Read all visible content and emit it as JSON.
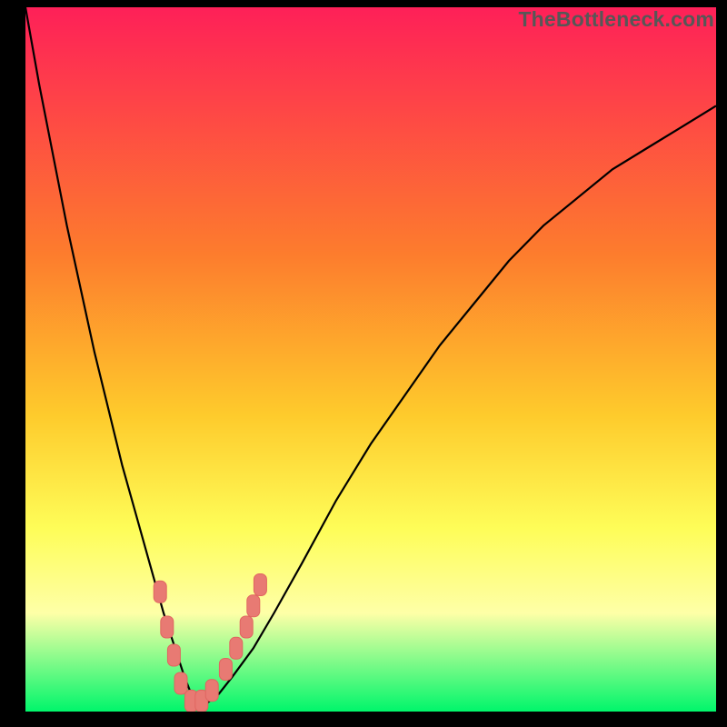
{
  "watermark": "TheBottleneck.com",
  "colors": {
    "gradient_top": "#fe2058",
    "gradient_mid1": "#fd7c2d",
    "gradient_mid2": "#fecb2c",
    "gradient_mid3": "#fefd58",
    "gradient_mid4": "#feffa7",
    "gradient_bottom": "#00f66b",
    "curve": "#000000",
    "marker_fill": "#e87a73",
    "marker_stroke": "#e06560"
  },
  "chart_data": {
    "type": "line",
    "title": "",
    "xlabel": "",
    "ylabel": "",
    "xlim": [
      0,
      100
    ],
    "ylim": [
      0,
      100
    ],
    "x": [
      0,
      2,
      4,
      6,
      8,
      10,
      12,
      14,
      16,
      18,
      20,
      21,
      22,
      23,
      24,
      25,
      26,
      28,
      30,
      33,
      36,
      40,
      45,
      50,
      55,
      60,
      65,
      70,
      75,
      80,
      85,
      90,
      95,
      100
    ],
    "y": [
      100,
      89,
      79,
      69,
      60,
      51,
      43,
      35,
      28,
      21,
      14,
      11,
      8,
      5,
      2.5,
      1,
      1,
      2.5,
      5,
      9,
      14,
      21,
      30,
      38,
      45,
      52,
      58,
      64,
      69,
      73,
      77,
      80,
      83,
      86
    ],
    "markers": [
      {
        "x": 19.5,
        "y": 17
      },
      {
        "x": 20.5,
        "y": 12
      },
      {
        "x": 21.5,
        "y": 8
      },
      {
        "x": 22.5,
        "y": 4
      },
      {
        "x": 24.0,
        "y": 1.5
      },
      {
        "x": 25.5,
        "y": 1.5
      },
      {
        "x": 27.0,
        "y": 3
      },
      {
        "x": 29.0,
        "y": 6
      },
      {
        "x": 30.5,
        "y": 9
      },
      {
        "x": 32.0,
        "y": 12
      },
      {
        "x": 33.0,
        "y": 15
      },
      {
        "x": 34.0,
        "y": 18
      }
    ]
  }
}
